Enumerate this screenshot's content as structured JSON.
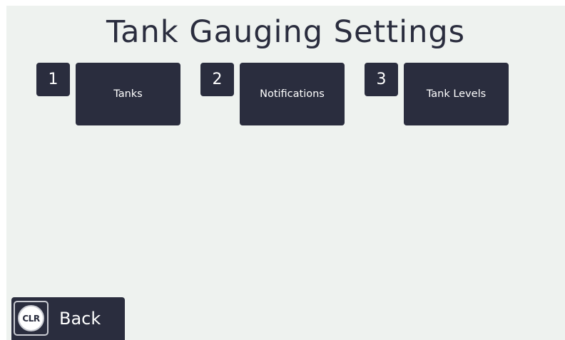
{
  "page": {
    "title": "Tank Gauging Settings"
  },
  "menu": [
    {
      "number": "1",
      "label": "Tanks"
    },
    {
      "number": "2",
      "label": "Notifications"
    },
    {
      "number": "3",
      "label": "Tank Levels"
    }
  ],
  "footer": {
    "clr_icon_text": "CLR",
    "back_label": "Back"
  },
  "colors": {
    "background": "#eef2ef",
    "button": "#2a2d3e",
    "button_text": "#ffffff",
    "title_text": "#2a2d3e"
  }
}
